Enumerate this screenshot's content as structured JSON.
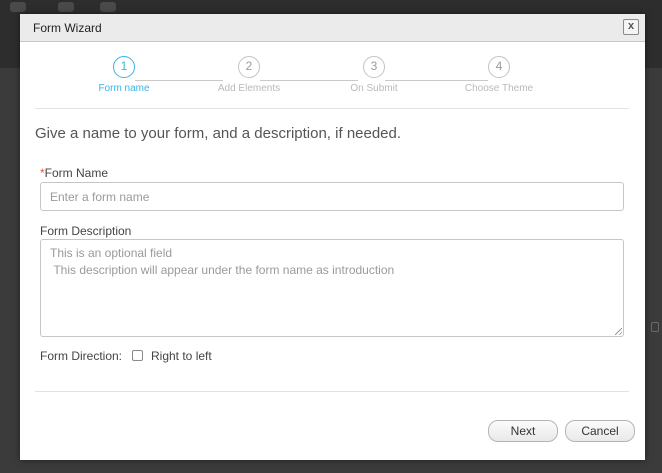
{
  "modal": {
    "title": "Form Wizard",
    "close_label": "x"
  },
  "stepper": {
    "steps": [
      {
        "number": "1",
        "label": "Form name",
        "active": true
      },
      {
        "number": "2",
        "label": "Add Elements",
        "active": false
      },
      {
        "number": "3",
        "label": "On Submit",
        "active": false
      },
      {
        "number": "4",
        "label": "Choose Theme",
        "active": false
      }
    ]
  },
  "intro_text": "Give a name to your form, and a description, if needed.",
  "form_name": {
    "required_mark": "*",
    "label": "Form Name",
    "value": "",
    "placeholder": "Enter a form name"
  },
  "form_description": {
    "label": "Form Description",
    "value": "",
    "placeholder": "This is an optional field\n This description will appear under the form name as introduction"
  },
  "direction": {
    "label": "Form Direction:",
    "option_label": "Right to left",
    "checked": false
  },
  "buttons": {
    "next": "Next",
    "cancel": "Cancel"
  },
  "colors": {
    "accent": "#3bb4e6",
    "required": "#e05a3c",
    "backdrop": "#3b3b3b"
  }
}
